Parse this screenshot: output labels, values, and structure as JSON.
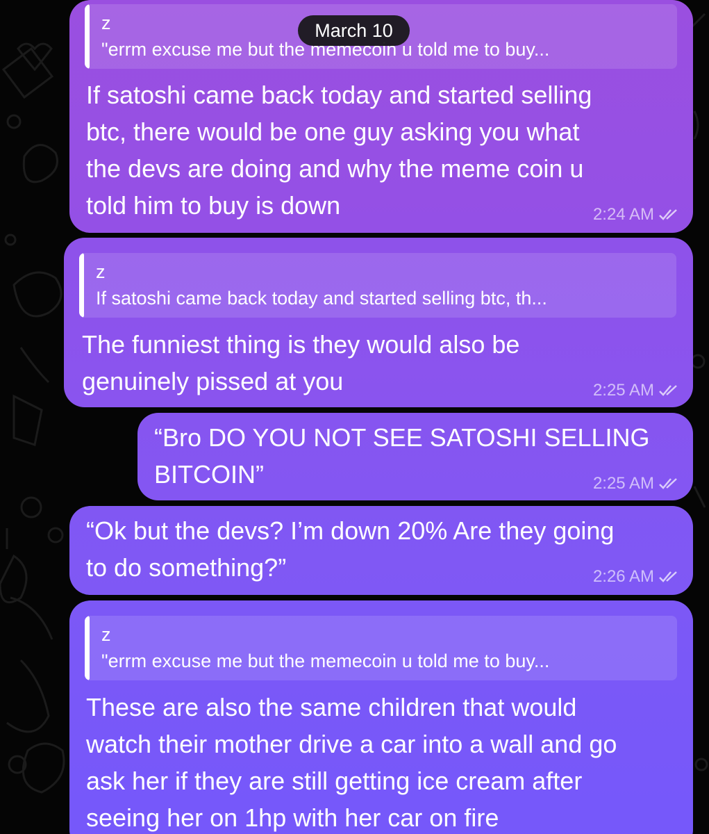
{
  "date_separator": "March 10",
  "colors": {
    "background": "#050505",
    "bubble_top": "#9a4fe0",
    "bubble_bottom": "#7a58f8"
  },
  "messages": [
    {
      "reply": {
        "name": "z",
        "text": "\"errm excuse me but the memecoin u told me to buy..."
      },
      "lines": [
        "If satoshi came back today and started  selling",
        "btc, there would be one guy asking you what",
        "the devs are doing and why the meme coin u",
        "told him to buy is down"
      ],
      "time": "2:24 AM",
      "status_icon": "double-check-icon"
    },
    {
      "reply": {
        "name": "z",
        "text": "If satoshi came back today and started selling btc, th..."
      },
      "lines": [
        "The funniest thing is they would also be",
        "genuinely pissed at you"
      ],
      "time": "2:25 AM",
      "status_icon": "double-check-icon"
    },
    {
      "lines": [
        "“Bro DO YOU NOT SEE SATOSHI SELLING",
        "BITCOIN”"
      ],
      "time": "2:25 AM",
      "status_icon": "double-check-icon"
    },
    {
      "lines": [
        "“Ok but the devs? I’m down 20% Are they going",
        "to do something?”"
      ],
      "time": "2:26 AM",
      "status_icon": "double-check-icon"
    },
    {
      "reply": {
        "name": "z",
        "text": "\"errm excuse me but the memecoin u told me to buy..."
      },
      "lines": [
        "These are also the same children that would",
        "watch their mother drive a car into a wall and go",
        "ask her if they are still getting ice cream after",
        "seeing her on 1hp with her car on fire"
      ]
    }
  ]
}
